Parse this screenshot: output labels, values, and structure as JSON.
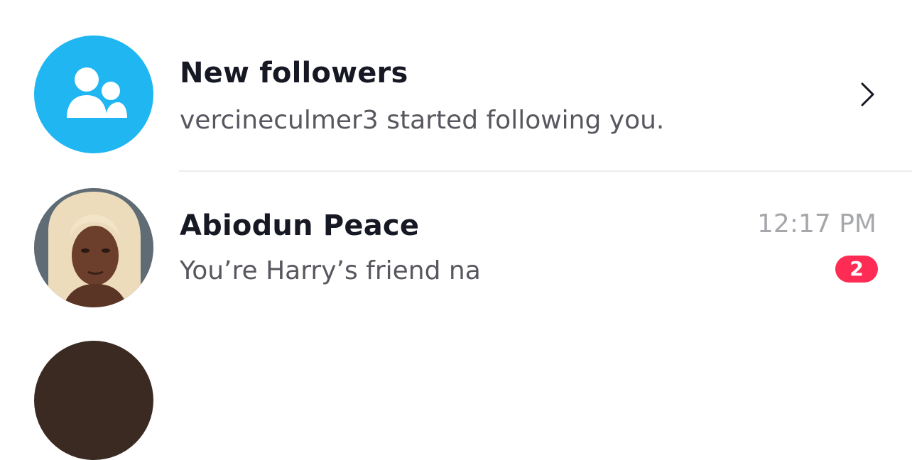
{
  "colors": {
    "accent_blue": "#1fb6f2",
    "badge_red": "#fe2c55",
    "title_text": "#161823",
    "subtitle_text": "#57575f",
    "time_text": "#a6a7ab",
    "divider": "#ececee"
  },
  "new_followers": {
    "icon": "followers-icon",
    "title": "New followers",
    "subtitle": "vercineculmer3 started following you.",
    "chevron_icon": "chevron-right-icon"
  },
  "conversations": [
    {
      "name": "Abiodun Peace",
      "message": "You’re Harry’s friend na",
      "time": "12:17 PM",
      "unread_count": "2",
      "avatar": "user-avatar"
    }
  ]
}
